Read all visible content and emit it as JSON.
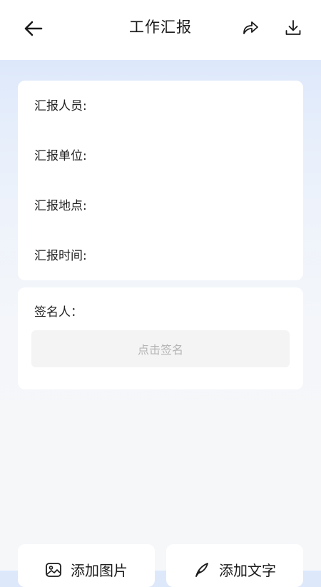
{
  "header": {
    "title": "工作汇报",
    "back_icon": "back-arrow-icon",
    "share_icon": "share-icon",
    "download_icon": "download-icon"
  },
  "info": {
    "reporter_label": "汇报人员:",
    "reporter_value": "",
    "unit_label": "汇报单位:",
    "unit_value": "",
    "location_label": "汇报地点:",
    "location_value": "",
    "time_label": "汇报时间:",
    "time_value": ""
  },
  "signature": {
    "label": "签名人：",
    "placeholder": "点击签名"
  },
  "actions": {
    "add_image_label": "添加图片",
    "add_image_icon": "image-icon",
    "add_text_label": "添加文字",
    "add_text_icon": "pen-icon"
  },
  "colors": {
    "text_primary": "#222222",
    "placeholder": "#b5b5b5",
    "card_bg": "#ffffff",
    "sign_area_bg": "#f4f4f4"
  }
}
